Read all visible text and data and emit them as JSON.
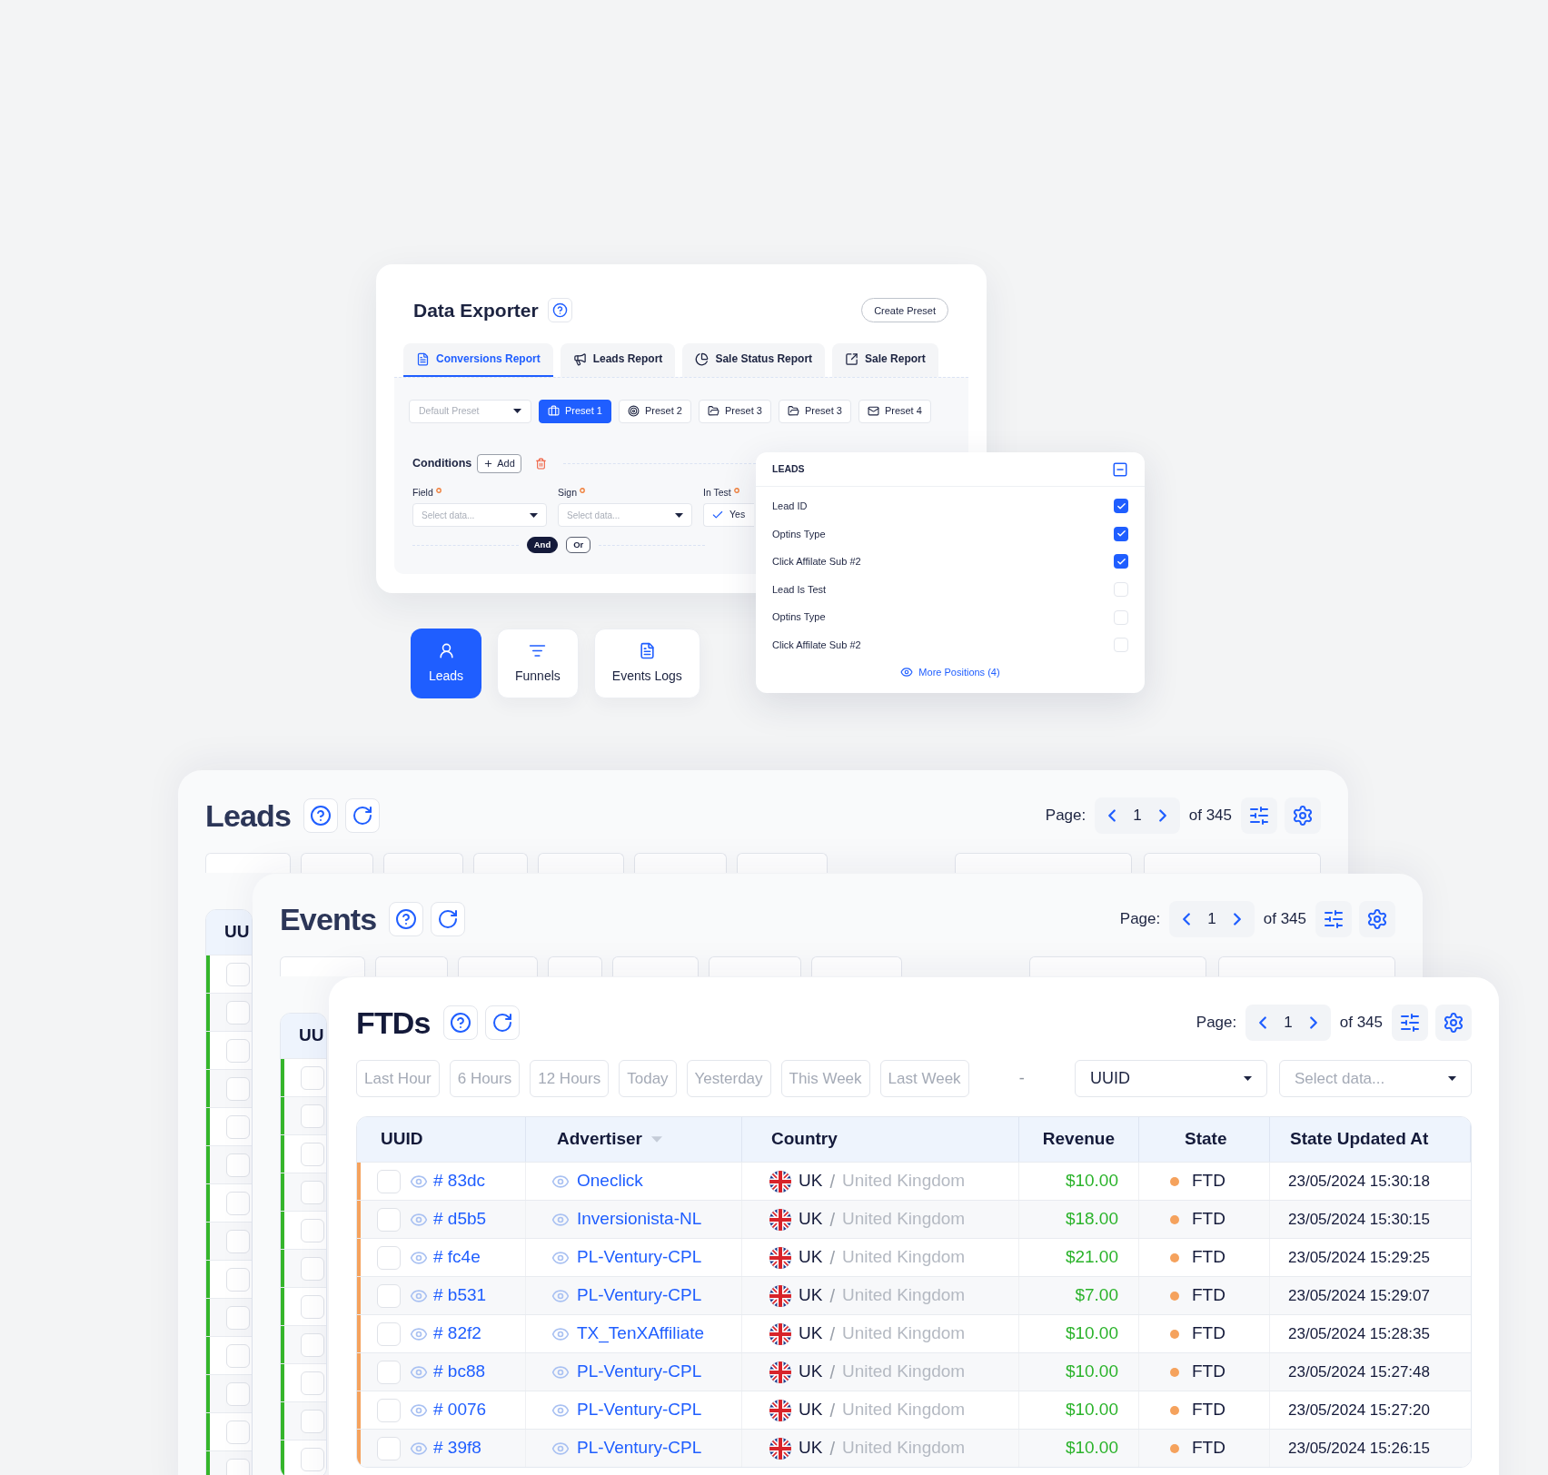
{
  "data_exporter": {
    "title": "Data Exporter",
    "create_button": "Create Preset",
    "tabs": [
      {
        "label": "Conversions Report",
        "selected": true
      },
      {
        "label": "Leads Report",
        "selected": false
      },
      {
        "label": "Sale Status Report",
        "selected": false
      },
      {
        "label": "Sale Report",
        "selected": false
      }
    ],
    "preset_select": {
      "placeholder": "Default Preset"
    },
    "presets": [
      {
        "label": "Preset 1",
        "selected": true
      },
      {
        "label": "Preset 2",
        "selected": false
      },
      {
        "label": "Preset 3",
        "selected": false
      },
      {
        "label": "Preset 3",
        "selected": false
      },
      {
        "label": "Preset 4",
        "selected": false
      }
    ],
    "conditions": {
      "label": "Conditions",
      "add_button": "Add"
    },
    "fields": [
      {
        "label": "Field",
        "required": true,
        "kind": "select",
        "placeholder": "Select data..."
      },
      {
        "label": "Sign",
        "required": true,
        "kind": "select",
        "placeholder": "Select data..."
      },
      {
        "label": "In Test",
        "required": true,
        "kind": "toggle",
        "value": "Yes",
        "checked": true
      }
    ],
    "logic": [
      {
        "label": "And",
        "selected": true
      },
      {
        "label": "Or",
        "selected": false
      }
    ]
  },
  "nav_buttons": [
    {
      "label": "Leads",
      "selected": true
    },
    {
      "label": "Funnels",
      "selected": false
    },
    {
      "label": "Events Logs",
      "selected": false
    }
  ],
  "leads_popup": {
    "title": "LEADS",
    "items": [
      {
        "label": "Lead ID",
        "checked": true
      },
      {
        "label": "Optins Type",
        "checked": true
      },
      {
        "label": "Click Affilate Sub #2",
        "checked": true
      },
      {
        "label": "Lead Is Test",
        "checked": false
      },
      {
        "label": "Optins Type",
        "checked": false
      },
      {
        "label": "Click Affilate Sub #2",
        "checked": false
      }
    ],
    "more_link": "More Positions (4)"
  },
  "panels": [
    {
      "title": "Leads",
      "page_label": "Page:",
      "page": "1",
      "page_total": "of 345",
      "table": {
        "columns": [
          {
            "label": "UU"
          }
        ],
        "rows": [
          {
            "color": "#35b52b",
            "checked": false
          },
          {
            "color": "#35b52b",
            "checked": false
          },
          {
            "color": "#35b52b",
            "checked": false
          },
          {
            "color": "#35b52b",
            "checked": false
          },
          {
            "color": "#35b52b",
            "checked": false
          },
          {
            "color": "#35b52b",
            "checked": false
          },
          {
            "color": "#35b52b",
            "checked": false
          },
          {
            "color": "#35b52b",
            "checked": false
          },
          {
            "color": "#35b52b",
            "checked": false
          },
          {
            "color": "#35b52b",
            "checked": false
          },
          {
            "color": "#35b52b",
            "checked": false
          },
          {
            "color": "#35b52b",
            "checked": false
          },
          {
            "color": "#35b52b",
            "checked": false
          },
          {
            "color": "#35b52b",
            "checked": false
          }
        ]
      }
    },
    {
      "title": "Events",
      "page_label": "Page:",
      "page": "1",
      "page_total": "of 345",
      "table": {
        "columns": [
          {
            "label": "UU"
          }
        ],
        "rows": [
          {
            "color": "#35b52b",
            "checked": false
          },
          {
            "color": "#35b52b",
            "checked": false
          },
          {
            "color": "#35b52b",
            "checked": false
          },
          {
            "color": "#35b52b",
            "checked": false
          },
          {
            "color": "#35b52b",
            "checked": false
          },
          {
            "color": "#35b52b",
            "checked": false
          },
          {
            "color": "#35b52b",
            "checked": false
          },
          {
            "color": "#35b52b",
            "checked": false
          },
          {
            "color": "#35b52b",
            "checked": false
          },
          {
            "color": "#35b52b",
            "checked": false
          },
          {
            "color": "#35b52b",
            "checked": false
          }
        ]
      }
    },
    {
      "title": "FTDs",
      "page_label": "Page:",
      "page": "1",
      "page_total": "of 345",
      "filters": [
        "Last Hour",
        "6 Hours",
        "12 Hours",
        "Today",
        "Yesterday",
        "This Week",
        "Last Week"
      ],
      "range_separator": "-",
      "id_select": "UUID",
      "data_select": {
        "placeholder": "Select data..."
      },
      "table": {
        "country_separator": "/",
        "columns": [
          {
            "label": "UUID",
            "sorted": false
          },
          {
            "label": "Advertiser",
            "sorted": true
          },
          {
            "label": "Country",
            "sorted": false
          },
          {
            "label": "Revenue",
            "sorted": false
          },
          {
            "label": "State",
            "sorted": false
          },
          {
            "label": "State Updated At",
            "sorted": false
          }
        ],
        "rows": [
          {
            "checked": false,
            "uuid": "# 83dc",
            "advertiser": "Oneclick",
            "country_code": "UK",
            "country_name": "United Kingdom",
            "revenue": "$10.00",
            "state": "FTD",
            "color": "#f5a25d",
            "updated": "23/05/2024 15:30:18"
          },
          {
            "checked": false,
            "uuid": "# d5b5",
            "advertiser": "Inversionista-NL",
            "country_code": "UK",
            "country_name": "United Kingdom",
            "revenue": "$18.00",
            "state": "FTD",
            "color": "#f5a25d",
            "updated": "23/05/2024 15:30:15"
          },
          {
            "checked": false,
            "uuid": "# fc4e",
            "advertiser": "PL-Ventury-CPL",
            "country_code": "UK",
            "country_name": "United Kingdom",
            "revenue": "$21.00",
            "state": "FTD",
            "color": "#f5a25d",
            "updated": "23/05/2024 15:29:25"
          },
          {
            "checked": false,
            "uuid": "# b531",
            "advertiser": "PL-Ventury-CPL",
            "country_code": "UK",
            "country_name": "United Kingdom",
            "revenue": "$7.00",
            "state": "FTD",
            "color": "#f5a25d",
            "updated": "23/05/2024 15:29:07"
          },
          {
            "checked": false,
            "uuid": "# 82f2",
            "advertiser": "TX_TenXAffiliate",
            "country_code": "UK",
            "country_name": "United Kingdom",
            "revenue": "$10.00",
            "state": "FTD",
            "color": "#f5a25d",
            "updated": "23/05/2024 15:28:35"
          },
          {
            "checked": false,
            "uuid": "# bc88",
            "advertiser": "PL-Ventury-CPL",
            "country_code": "UK",
            "country_name": "United Kingdom",
            "revenue": "$10.00",
            "state": "FTD",
            "color": "#f5a25d",
            "updated": "23/05/2024 15:27:48"
          },
          {
            "checked": false,
            "uuid": "# 0076",
            "advertiser": "PL-Ventury-CPL",
            "country_code": "UK",
            "country_name": "United Kingdom",
            "revenue": "$10.00",
            "state": "FTD",
            "color": "#f5a25d",
            "updated": "23/05/2024 15:27:20"
          },
          {
            "checked": false,
            "uuid": "# 39f8",
            "advertiser": "PL-Ventury-CPL",
            "country_code": "UK",
            "country_name": "United Kingdom",
            "revenue": "$10.00",
            "state": "FTD",
            "color": "#f5a25d",
            "updated": "23/05/2024 15:26:15"
          }
        ]
      }
    }
  ]
}
